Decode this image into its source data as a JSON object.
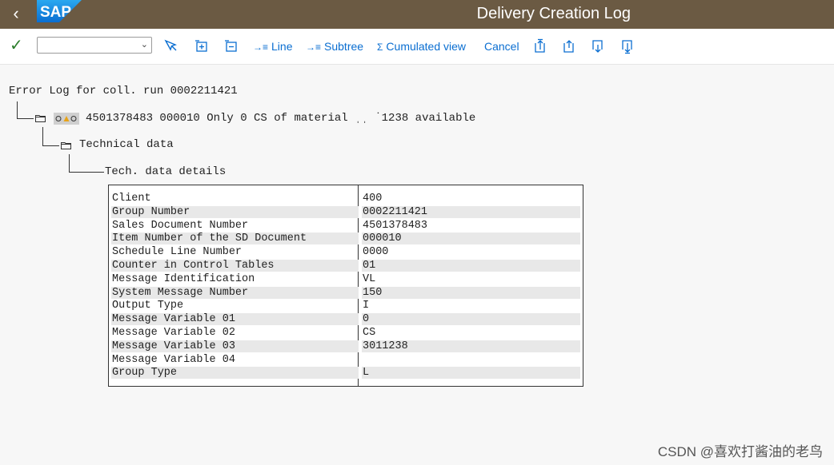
{
  "header": {
    "logo_text": "SAP",
    "title": "Delivery Creation Log",
    "back_icon": "chevron-left-icon"
  },
  "toolbar": {
    "confirm_icon": "checkmark-icon",
    "dropdown_value": "",
    "line_label": "Line",
    "subtree_label": "Subtree",
    "cumulated_label": "Cumulated view",
    "cancel_label": "Cancel",
    "icons": [
      "select-detail-icon",
      "expand-node-icon",
      "collapse-node-icon",
      "first-page-icon",
      "previous-page-icon",
      "next-page-icon",
      "last-page-icon"
    ]
  },
  "log": {
    "heading": "Error Log for coll. run 0002211421",
    "message": "4501378483 000010 Only 0 CS of material ˌˌ ˙1238 available",
    "technical_node": "Technical data",
    "details_node": "Tech. data details",
    "status_lights": [
      "grey",
      "amber",
      "grey"
    ]
  },
  "details": {
    "rows": [
      {
        "key": "Client",
        "value": "400"
      },
      {
        "key": "Group Number",
        "value": "0002211421"
      },
      {
        "key": "Sales Document Number",
        "value": "4501378483"
      },
      {
        "key": "Item Number of the SD Document",
        "value": "000010"
      },
      {
        "key": "Schedule Line Number",
        "value": "0000"
      },
      {
        "key": "Counter in Control Tables",
        "value": "01"
      },
      {
        "key": "Message Identification",
        "value": "VL"
      },
      {
        "key": "System Message Number",
        "value": "150"
      },
      {
        "key": "Output Type",
        "value": "I"
      },
      {
        "key": "Message Variable 01",
        "value": "0"
      },
      {
        "key": "Message Variable 02",
        "value": "CS"
      },
      {
        "key": "Message Variable 03",
        "value": "3011238"
      },
      {
        "key": "Message Variable 04",
        "value": ""
      },
      {
        "key": "Group Type",
        "value": "L"
      }
    ]
  },
  "watermark": "CSDN @喜欢打酱油的老鸟",
  "colors": {
    "shell": "#6b5a43",
    "link": "#0a6ed1",
    "confirm": "#2b7d2b",
    "row_shade": "#e8e8e8",
    "light_amber": "#e8a317"
  }
}
